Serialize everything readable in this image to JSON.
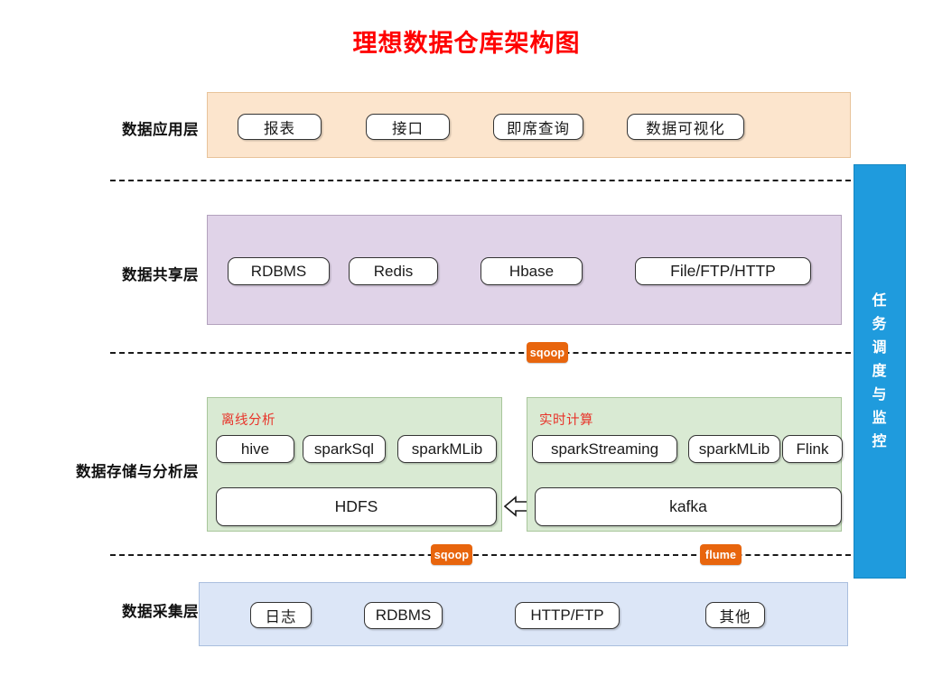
{
  "title": "理想数据仓库架构图",
  "side_panel": {
    "label": "任务调度与监控",
    "color": "#1f9bdd"
  },
  "layers": [
    {
      "name": "data-application-layer",
      "label": "数据应用层",
      "band_color": "#fce5cd",
      "nodes": [
        "报表",
        "接口",
        "即席查询",
        "数据可视化"
      ]
    },
    {
      "name": "data-sharing-layer",
      "label": "数据共享层",
      "band_color": "#e0d3e8",
      "nodes": [
        "RDBMS",
        "Redis",
        "Hbase",
        "File/FTP/HTTP"
      ]
    },
    {
      "name": "data-storage-analysis-layer",
      "label": "数据存储与分析层",
      "band_color": "#d9ead3",
      "groups": [
        {
          "caption": "离线分析",
          "nodes": [
            "hive",
            "sparkSql",
            "sparkMLib"
          ],
          "base": "HDFS"
        },
        {
          "caption": "实时计算",
          "nodes": [
            "sparkStreaming",
            "sparkMLib",
            "Flink"
          ],
          "base": "kafka"
        }
      ]
    },
    {
      "name": "data-collection-layer",
      "label": "数据采集层",
      "band_color": "#dce6f7",
      "nodes": [
        "日志",
        "RDBMS",
        "HTTP/FTP",
        "其他"
      ]
    }
  ],
  "badges": [
    {
      "label": "sqoop",
      "color": "#e8650d"
    },
    {
      "label": "sqoop",
      "color": "#e8650d"
    },
    {
      "label": "flume",
      "color": "#e8650d"
    }
  ]
}
